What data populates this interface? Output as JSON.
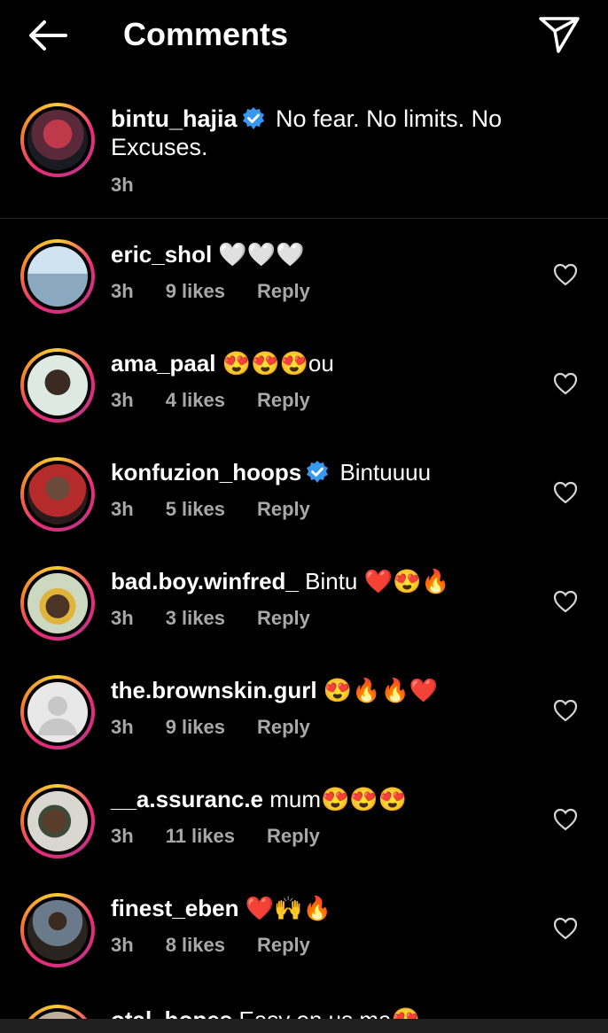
{
  "header": {
    "title": "Comments"
  },
  "caption": {
    "username": "bintu_hajia",
    "verified": true,
    "text": "No fear. No limits. No Excuses.",
    "time": "3h"
  },
  "comments": [
    {
      "username": "eric_shol",
      "verified": false,
      "text": "🤍🤍🤍",
      "time": "3h",
      "likes": "9 likes",
      "reply": "Reply"
    },
    {
      "username": "ama_paal",
      "verified": false,
      "text": "😍😍😍ou",
      "time": "3h",
      "likes": "4 likes",
      "reply": "Reply"
    },
    {
      "username": "konfuzion_hoops",
      "verified": true,
      "text": "Bintuuuu",
      "time": "3h",
      "likes": "5 likes",
      "reply": "Reply"
    },
    {
      "username": "bad.boy.winfred_",
      "verified": false,
      "text": "Bintu ❤️😍🔥",
      "time": "3h",
      "likes": "3 likes",
      "reply": "Reply"
    },
    {
      "username": "the.brownskin.gurl",
      "verified": false,
      "text": "😍🔥🔥❤️",
      "time": "3h",
      "likes": "9 likes",
      "reply": "Reply"
    },
    {
      "username": "__a.ssuranc.e",
      "verified": false,
      "text": "mum😍😍😍",
      "time": "3h",
      "likes": "11 likes",
      "reply": "Reply"
    },
    {
      "username": "finest_eben",
      "verified": false,
      "text": "❤️🙌🔥",
      "time": "3h",
      "likes": "8 likes",
      "reply": "Reply"
    }
  ],
  "partial_comment": {
    "username": "otal_hopes",
    "text": "Easy on us ma😍"
  },
  "colors": {
    "background": "#000000",
    "secondary_text": "#a8a8a8",
    "verified": "#3897f0"
  }
}
